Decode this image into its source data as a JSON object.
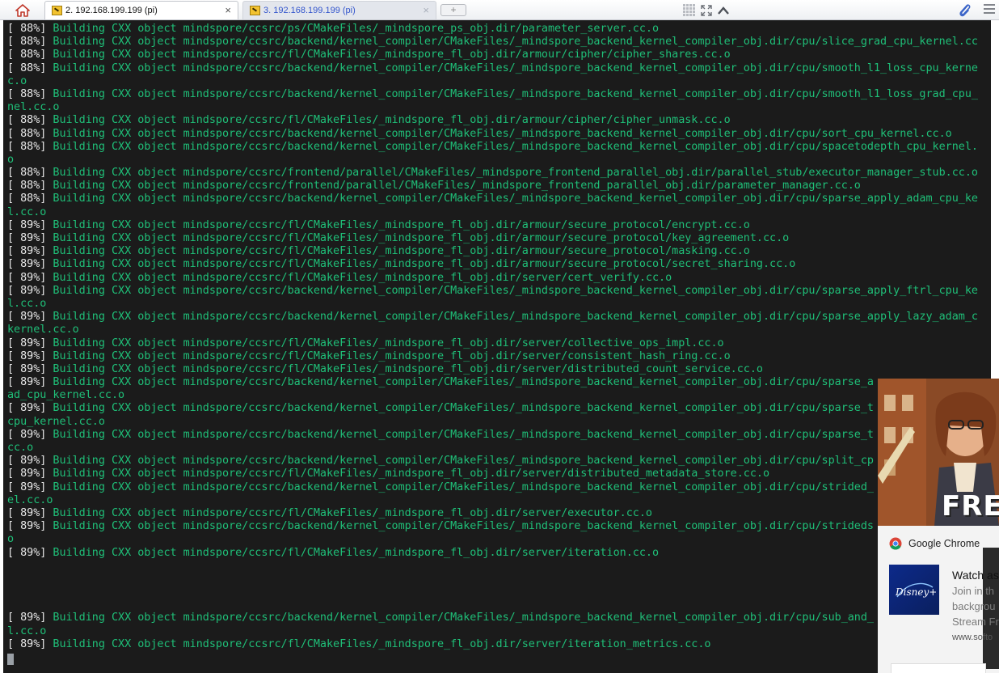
{
  "tabs": [
    {
      "title": "2. 192.168.199.199 (pi)",
      "close": "×",
      "active": true
    },
    {
      "title": "3. 192.168.199.199 (pi)",
      "close": "×",
      "active": false
    }
  ],
  "new_tab_label": "+",
  "icons": {
    "home": "home-icon",
    "tab": "putty-terminal-icon",
    "grid": "grid-icon",
    "fullscreen": "fullscreen-icon",
    "collapse": "chevron-up-icon",
    "attach": "paperclip-icon",
    "menu": "hamburger-menu-icon",
    "chrome": "google-chrome-icon",
    "disney": "disney-plus-logo"
  },
  "colors": {
    "terminal_bg": "#1b1b1b",
    "terminal_text": "#1fbf78",
    "percent_text": "#e8e8e8",
    "active_tab_text": "#111111",
    "inactive_tab_text": "#3355cc"
  },
  "terminal": {
    "lines": [
      {
        "pct": "[ 88%] ",
        "text": "Building CXX object mindspore/ccsrc/ps/CMakeFiles/_mindspore_ps_obj.dir/parameter_server.cc.o"
      },
      {
        "pct": "[ 88%] ",
        "text": "Building CXX object mindspore/ccsrc/backend/kernel_compiler/CMakeFiles/_mindspore_backend_kernel_compiler_obj.dir/cpu/slice_grad_cpu_kernel.cc"
      },
      {
        "pct": "[ 88%] ",
        "text": "Building CXX object mindspore/ccsrc/fl/CMakeFiles/_mindspore_fl_obj.dir/armour/cipher/cipher_shares.cc.o"
      },
      {
        "pct": "[ 88%] ",
        "text": "Building CXX object mindspore/ccsrc/backend/kernel_compiler/CMakeFiles/_mindspore_backend_kernel_compiler_obj.dir/cpu/smooth_l1_loss_cpu_kerne"
      },
      {
        "pct": "",
        "text": "c.o"
      },
      {
        "pct": "[ 88%] ",
        "text": "Building CXX object mindspore/ccsrc/backend/kernel_compiler/CMakeFiles/_mindspore_backend_kernel_compiler_obj.dir/cpu/smooth_l1_loss_grad_cpu_"
      },
      {
        "pct": "",
        "text": "nel.cc.o"
      },
      {
        "pct": "[ 88%] ",
        "text": "Building CXX object mindspore/ccsrc/fl/CMakeFiles/_mindspore_fl_obj.dir/armour/cipher/cipher_unmask.cc.o"
      },
      {
        "pct": "[ 88%] ",
        "text": "Building CXX object mindspore/ccsrc/backend/kernel_compiler/CMakeFiles/_mindspore_backend_kernel_compiler_obj.dir/cpu/sort_cpu_kernel.cc.o"
      },
      {
        "pct": "[ 88%] ",
        "text": "Building CXX object mindspore/ccsrc/backend/kernel_compiler/CMakeFiles/_mindspore_backend_kernel_compiler_obj.dir/cpu/spacetodepth_cpu_kernel."
      },
      {
        "pct": "",
        "text": "o"
      },
      {
        "pct": "[ 88%] ",
        "text": "Building CXX object mindspore/ccsrc/frontend/parallel/CMakeFiles/_mindspore_frontend_parallel_obj.dir/parallel_stub/executor_manager_stub.cc.o"
      },
      {
        "pct": "[ 88%] ",
        "text": "Building CXX object mindspore/ccsrc/frontend/parallel/CMakeFiles/_mindspore_frontend_parallel_obj.dir/parameter_manager.cc.o"
      },
      {
        "pct": "[ 88%] ",
        "text": "Building CXX object mindspore/ccsrc/backend/kernel_compiler/CMakeFiles/_mindspore_backend_kernel_compiler_obj.dir/cpu/sparse_apply_adam_cpu_ke"
      },
      {
        "pct": "",
        "text": "l.cc.o"
      },
      {
        "pct": "[ 89%] ",
        "text": "Building CXX object mindspore/ccsrc/fl/CMakeFiles/_mindspore_fl_obj.dir/armour/secure_protocol/encrypt.cc.o"
      },
      {
        "pct": "[ 89%] ",
        "text": "Building CXX object mindspore/ccsrc/fl/CMakeFiles/_mindspore_fl_obj.dir/armour/secure_protocol/key_agreement.cc.o"
      },
      {
        "pct": "[ 89%] ",
        "text": "Building CXX object mindspore/ccsrc/fl/CMakeFiles/_mindspore_fl_obj.dir/armour/secure_protocol/masking.cc.o"
      },
      {
        "pct": "[ 89%] ",
        "text": "Building CXX object mindspore/ccsrc/fl/CMakeFiles/_mindspore_fl_obj.dir/armour/secure_protocol/secret_sharing.cc.o"
      },
      {
        "pct": "[ 89%] ",
        "text": "Building CXX object mindspore/ccsrc/fl/CMakeFiles/_mindspore_fl_obj.dir/server/cert_verify.cc.o"
      },
      {
        "pct": "[ 89%] ",
        "text": "Building CXX object mindspore/ccsrc/backend/kernel_compiler/CMakeFiles/_mindspore_backend_kernel_compiler_obj.dir/cpu/sparse_apply_ftrl_cpu_ke"
      },
      {
        "pct": "",
        "text": "l.cc.o"
      },
      {
        "pct": "[ 89%] ",
        "text": "Building CXX object mindspore/ccsrc/backend/kernel_compiler/CMakeFiles/_mindspore_backend_kernel_compiler_obj.dir/cpu/sparse_apply_lazy_adam_c"
      },
      {
        "pct": "",
        "text": "kernel.cc.o"
      },
      {
        "pct": "[ 89%] ",
        "text": "Building CXX object mindspore/ccsrc/fl/CMakeFiles/_mindspore_fl_obj.dir/server/collective_ops_impl.cc.o"
      },
      {
        "pct": "[ 89%] ",
        "text": "Building CXX object mindspore/ccsrc/fl/CMakeFiles/_mindspore_fl_obj.dir/server/consistent_hash_ring.cc.o"
      },
      {
        "pct": "[ 89%] ",
        "text": "Building CXX object mindspore/ccsrc/fl/CMakeFiles/_mindspore_fl_obj.dir/server/distributed_count_service.cc.o"
      },
      {
        "pct": "[ 89%] ",
        "text": "Building CXX object mindspore/ccsrc/backend/kernel_compiler/CMakeFiles/_mindspore_backend_kernel_compiler_obj.dir/cpu/sparse_a"
      },
      {
        "pct": "",
        "text": "ad_cpu_kernel.cc.o"
      },
      {
        "pct": "[ 89%] ",
        "text": "Building CXX object mindspore/ccsrc/backend/kernel_compiler/CMakeFiles/_mindspore_backend_kernel_compiler_obj.dir/cpu/sparse_t"
      },
      {
        "pct": "",
        "text": "cpu_kernel.cc.o"
      },
      {
        "pct": "[ 89%] ",
        "text": "Building CXX object mindspore/ccsrc/backend/kernel_compiler/CMakeFiles/_mindspore_backend_kernel_compiler_obj.dir/cpu/sparse_t"
      },
      {
        "pct": "",
        "text": "cc.o"
      },
      {
        "pct": "[ 89%] ",
        "text": "Building CXX object mindspore/ccsrc/backend/kernel_compiler/CMakeFiles/_mindspore_backend_kernel_compiler_obj.dir/cpu/split_cp"
      },
      {
        "pct": "[ 89%] ",
        "text": "Building CXX object mindspore/ccsrc/fl/CMakeFiles/_mindspore_fl_obj.dir/server/distributed_metadata_store.cc.o"
      },
      {
        "pct": "[ 89%] ",
        "text": "Building CXX object mindspore/ccsrc/backend/kernel_compiler/CMakeFiles/_mindspore_backend_kernel_compiler_obj.dir/cpu/strided_"
      },
      {
        "pct": "",
        "text": "el.cc.o"
      },
      {
        "pct": "[ 89%] ",
        "text": "Building CXX object mindspore/ccsrc/fl/CMakeFiles/_mindspore_fl_obj.dir/server/executor.cc.o"
      },
      {
        "pct": "[ 89%] ",
        "text": "Building CXX object mindspore/ccsrc/backend/kernel_compiler/CMakeFiles/_mindspore_backend_kernel_compiler_obj.dir/cpu/strideds"
      },
      {
        "pct": "",
        "text": "o"
      },
      {
        "pct": "[ 89%] ",
        "text": "Building CXX object mindspore/ccsrc/fl/CMakeFiles/_mindspore_fl_obj.dir/server/iteration.cc.o"
      },
      {
        "pct": "",
        "text": ""
      },
      {
        "pct": "",
        "text": ""
      },
      {
        "pct": "",
        "text": ""
      },
      {
        "pct": "",
        "text": ""
      },
      {
        "pct": "[ 89%] ",
        "text": "Building CXX object mindspore/ccsrc/backend/kernel_compiler/CMakeFiles/_mindspore_backend_kernel_compiler_obj.dir/cpu/sub_and_"
      },
      {
        "pct": "",
        "text": "l.cc.o"
      },
      {
        "pct": "[ 89%] ",
        "text": "Building CXX object mindspore/ccsrc/fl/CMakeFiles/_mindspore_fl_obj.dir/server/iteration_metrics.cc.o"
      }
    ]
  },
  "ad": {
    "image_text": "FRE"
  },
  "notification": {
    "app_name": "Google Chrome",
    "logo_text": "Disney+",
    "title": "Watch as",
    "body_lines": [
      "Join in th",
      "backgrou",
      "Stream Fr"
    ],
    "domain": "www.softo"
  }
}
